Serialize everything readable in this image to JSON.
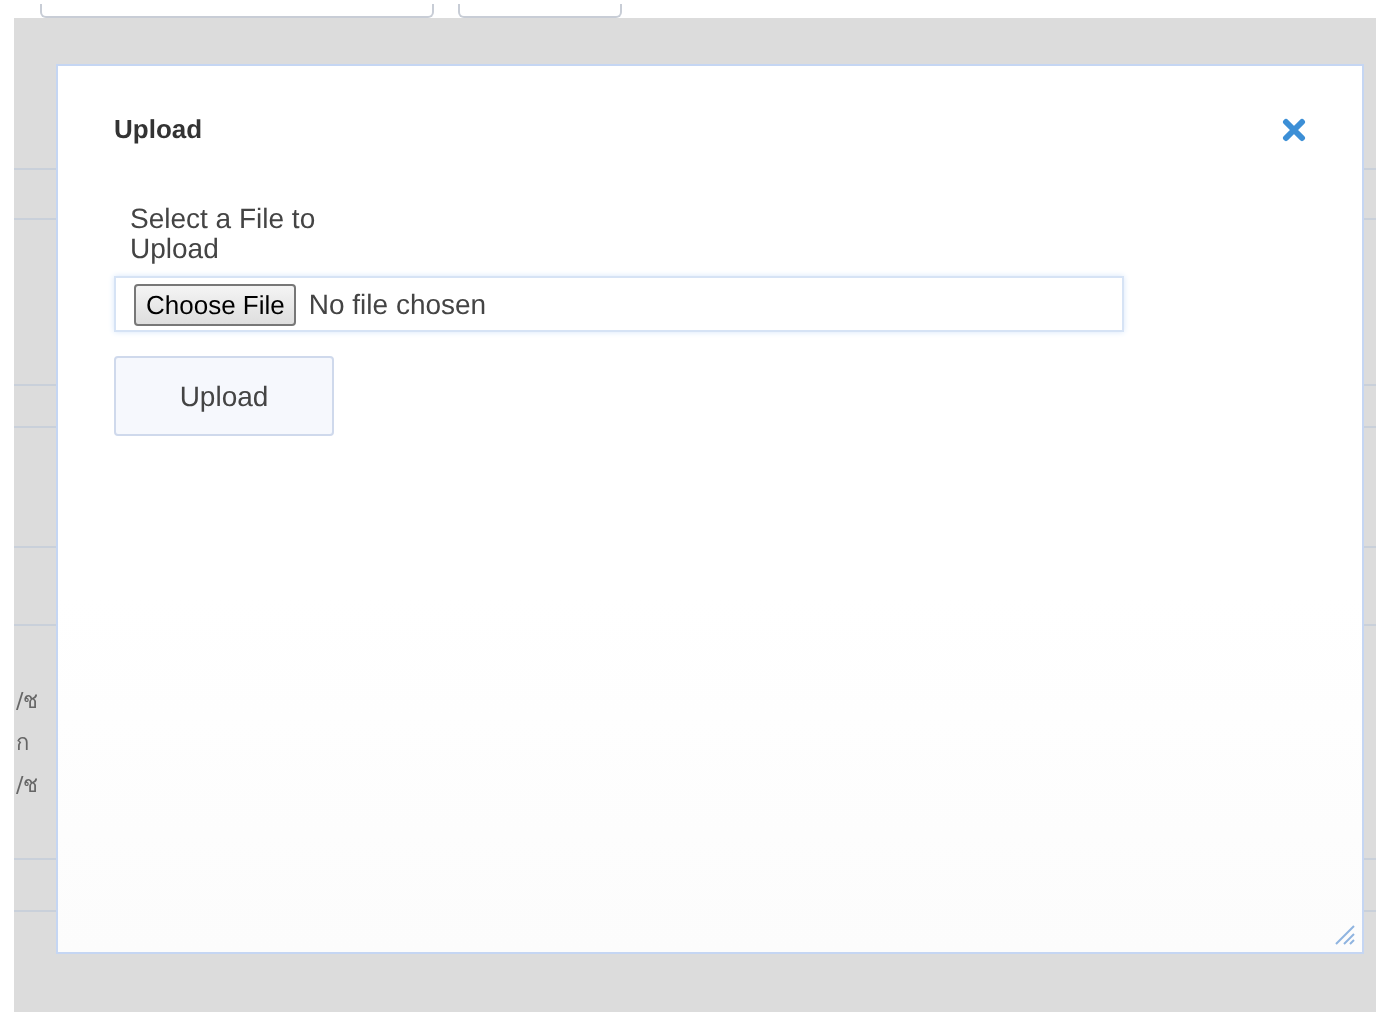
{
  "dialog": {
    "title": "Upload",
    "prompt": "Select a File to Upload",
    "file_button": "Choose File",
    "file_status": "No file chosen",
    "submit": "Upload"
  },
  "background_texts": [
    "/ช",
    "ก",
    "/ช"
  ]
}
